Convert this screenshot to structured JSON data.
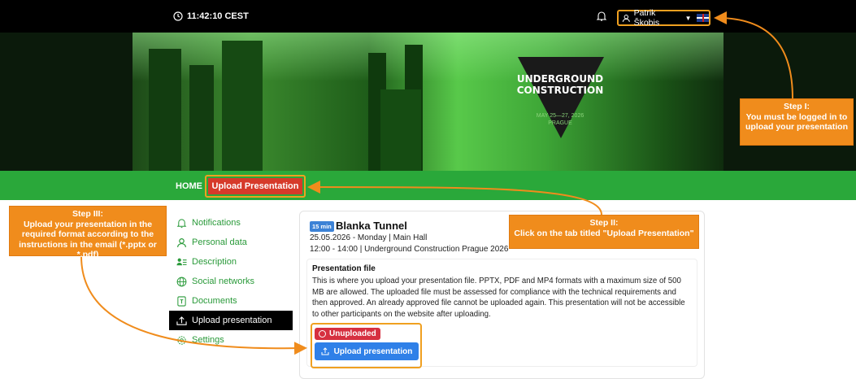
{
  "topbar": {
    "time": "11:42:10 CEST",
    "clock_icon": "clock-icon",
    "bell_icon": "bell-icon",
    "user_name": "Patrik Škobis",
    "user_icon": "user-icon",
    "flag_icon": "uk-flag-icon"
  },
  "banner": {
    "logo_line1": "UNDERGROUND",
    "logo_line2": "CONSTRUCTION",
    "logo_date": "MAY 25—27, 2026",
    "logo_city": "PRAGUE"
  },
  "nav": {
    "home": "HOME",
    "upload": "Upload Presentation"
  },
  "sidebar": {
    "items": [
      {
        "label": "Notifications",
        "icon": "bell-icon"
      },
      {
        "label": "Personal data",
        "icon": "user-icon"
      },
      {
        "label": "Description",
        "icon": "description-icon"
      },
      {
        "label": "Social networks",
        "icon": "globe-icon"
      },
      {
        "label": "Documents",
        "icon": "document-icon"
      },
      {
        "label": "Upload presentation",
        "icon": "upload-icon"
      },
      {
        "label": "Settings",
        "icon": "gear-icon"
      }
    ]
  },
  "card": {
    "badge": "15 min",
    "title": "Blanka Tunnel",
    "line1": "25.05.2026 - Monday | Main Hall",
    "line2": "12:00 - 14:00 | Underground Construction Prague 2026",
    "file_title": "Presentation file",
    "file_text": "This is where you upload your presentation file. PPTX, PDF and MP4 formats with a maximum size of 500 MB are allowed. The uploaded file must be assessed for compliance with the technical requirements and then approved. An already approved file cannot be uploaded again. This presentation will not be accessible to other participants on the website after uploading.",
    "status": "Unuploaded",
    "upload_button": "Upload presentation"
  },
  "callouts": {
    "step1_title": "Step I:",
    "step1_body": "You must be logged in to upload your presentation",
    "step2_title": "Step II:",
    "step2_body": "Click on the tab titled \"Upload Presentation\"",
    "step3_title": "Step III:",
    "step3_body": "Upload your presentation in the required format according to the instructions in the email (*.pptx or *.pdf)"
  },
  "colors": {
    "accent_green": "#2aa83a",
    "nav_red": "#d63a2a",
    "callout_orange": "#f08c1c",
    "button_blue": "#2f80e8"
  }
}
